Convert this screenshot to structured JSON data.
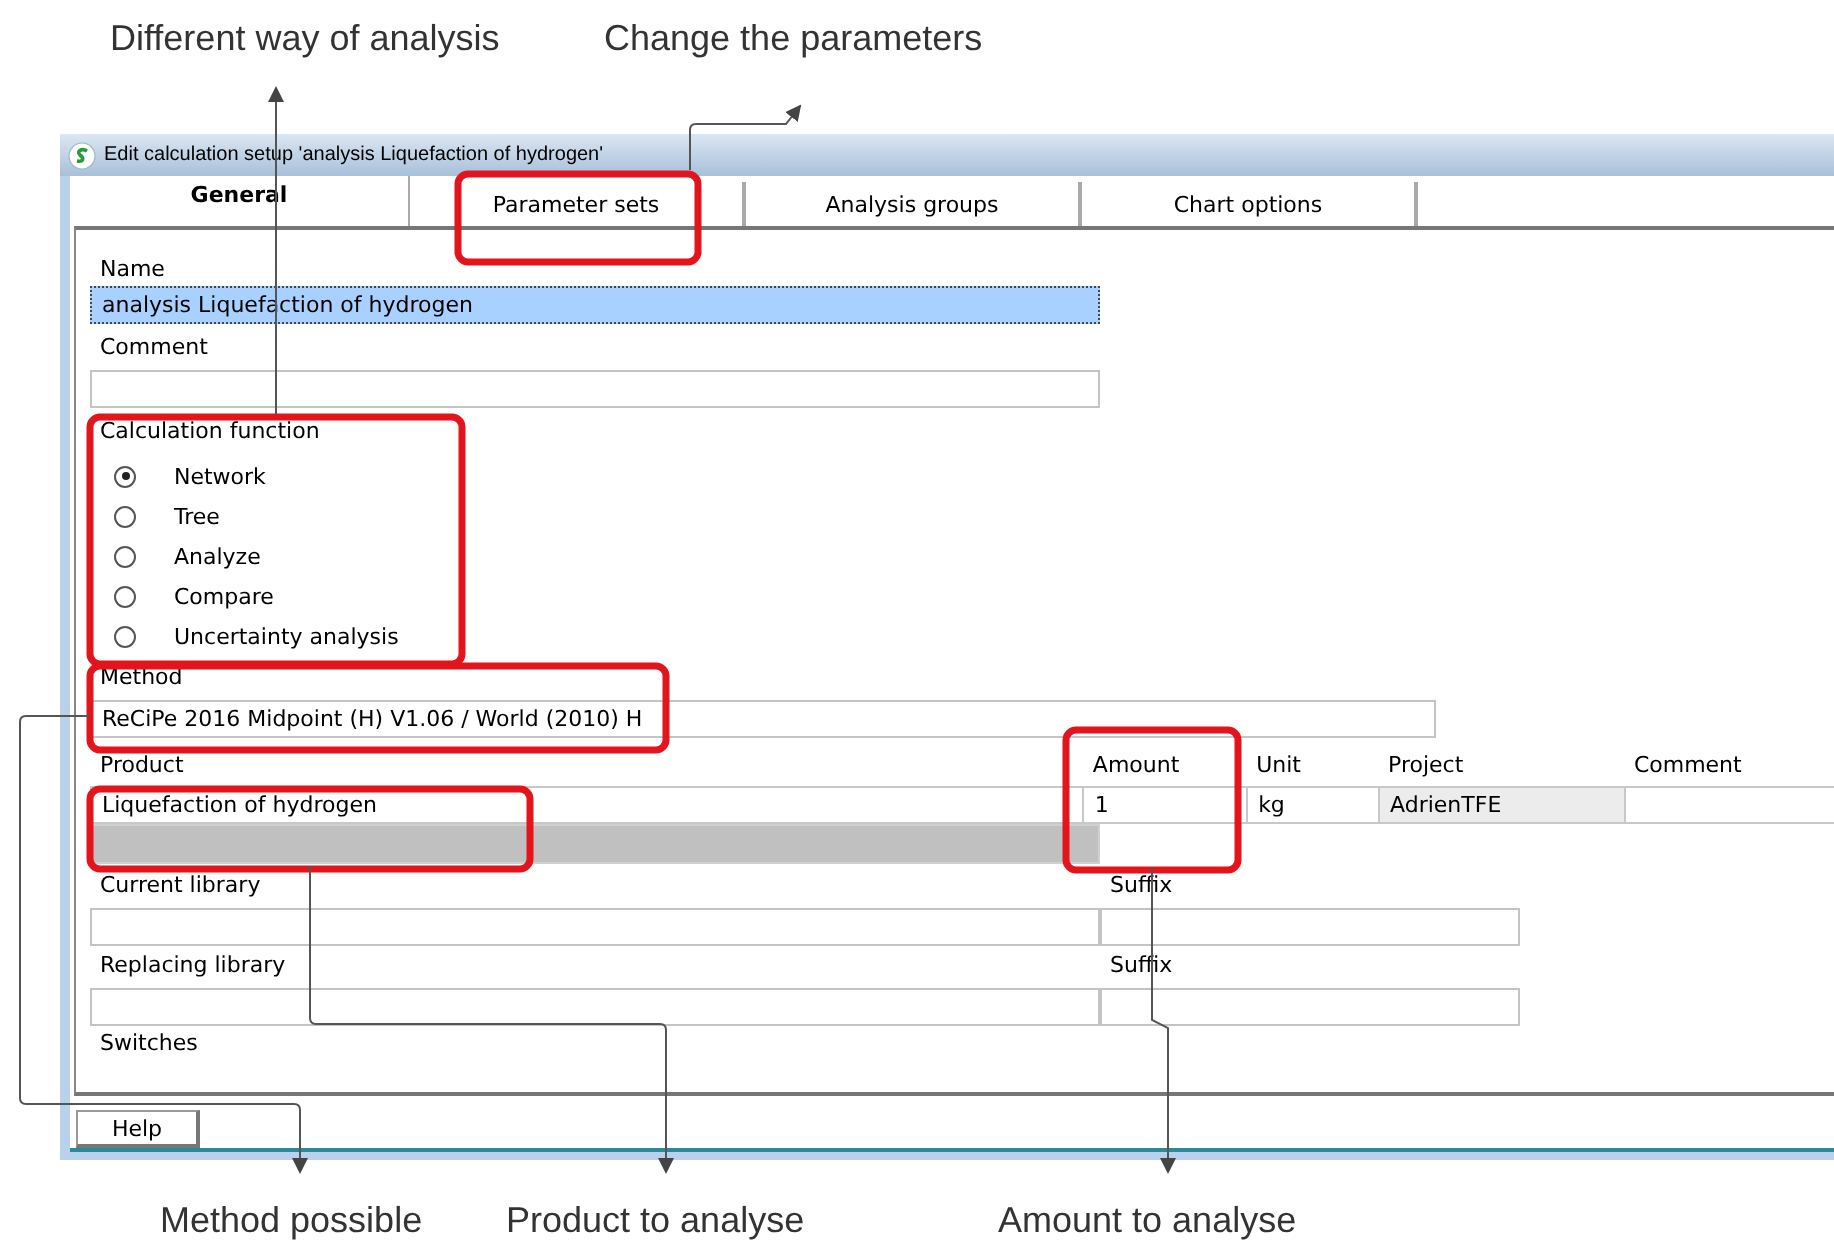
{
  "callouts_top": [
    "Different way of analysis",
    "Change the parameters"
  ],
  "window": {
    "title": "Edit calculation setup 'analysis Liquefaction of hydrogen'"
  },
  "tabs": [
    {
      "label": "General",
      "selected": true
    },
    {
      "label": "Parameter sets",
      "selected": false
    },
    {
      "label": "Analysis groups",
      "selected": false
    },
    {
      "label": "Chart options",
      "selected": false
    }
  ],
  "name": {
    "label": "Name",
    "value": "analysis Liquefaction of hydrogen",
    "text_selected": true
  },
  "comment": {
    "label": "Comment"
  },
  "calculation_function": {
    "label": "Calculation function",
    "options": [
      {
        "label": "Network",
        "selected": true
      },
      {
        "label": "Tree",
        "selected": false
      },
      {
        "label": "Analyze",
        "selected": false
      },
      {
        "label": "Compare",
        "selected": false
      },
      {
        "label": "Uncertainty analysis",
        "selected": false
      }
    ]
  },
  "method": {
    "label": "Method",
    "value": "ReCiPe 2016 Midpoint (H) V1.06 / World (2010) H"
  },
  "product_table": {
    "columns": [
      "Product",
      "Amount",
      "Unit",
      "Project",
      "Comment"
    ],
    "rows": [
      {
        "selected": false,
        "cells": [
          {
            "text": "Liquefaction of hydrogen",
            "readonly": false
          },
          {
            "text": "1",
            "readonly": false
          },
          {
            "text": "kg",
            "readonly": false
          },
          {
            "text": "AdrienTFE",
            "readonly": true
          }
        ]
      },
      {
        "selected": true
      }
    ]
  },
  "libraries": [
    {
      "label": "Current library",
      "suffix_label": "Suffix"
    },
    {
      "label": "Replacing library",
      "suffix_label": "Suffix"
    }
  ],
  "switches": {
    "label": "Switches"
  },
  "help_button": "Help",
  "callouts_bottom": [
    "Method possible",
    "Product to analyse",
    "Amount to analyse"
  ]
}
